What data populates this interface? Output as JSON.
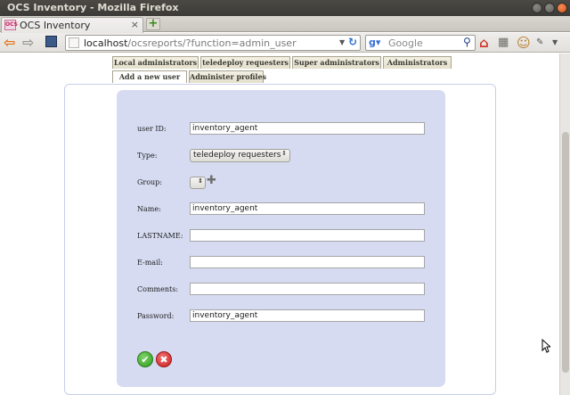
{
  "window": {
    "title": "OCS Inventory - Mozilla Firefox"
  },
  "browser": {
    "tab_title": "OCS Inventory",
    "favicon_text": "OCS",
    "url_host": "localhost",
    "url_path": "/ocsreports/?function=admin_user",
    "search_placeholder": "Google"
  },
  "tabs_row1": [
    {
      "label": "Local administrators"
    },
    {
      "label": "teledeploy requesters"
    },
    {
      "label": "Super administrators"
    },
    {
      "label": "Administrators"
    }
  ],
  "tabs_row2": [
    {
      "label": "Add a new user",
      "active": true
    },
    {
      "label": "Administer profiles",
      "active": false
    }
  ],
  "form": {
    "user_id": {
      "label": "user ID:",
      "value": "inventory_agent"
    },
    "type": {
      "label": "Type:",
      "value": "teledeploy requesters"
    },
    "group": {
      "label": "Group:",
      "value": ""
    },
    "name": {
      "label": "Name:",
      "value": "inventory_agent"
    },
    "lastname": {
      "label": "LASTNAME:",
      "value": ""
    },
    "email": {
      "label": "E-mail:",
      "value": ""
    },
    "comments": {
      "label": "Comments:",
      "value": ""
    },
    "password": {
      "label": "Password:",
      "value": "inventory_agent"
    }
  },
  "colors": {
    "panel": "#d6dbf2",
    "tab_bg": "#e8e3d0",
    "ok_button": "#3aa826",
    "cancel_button": "#d22424"
  }
}
